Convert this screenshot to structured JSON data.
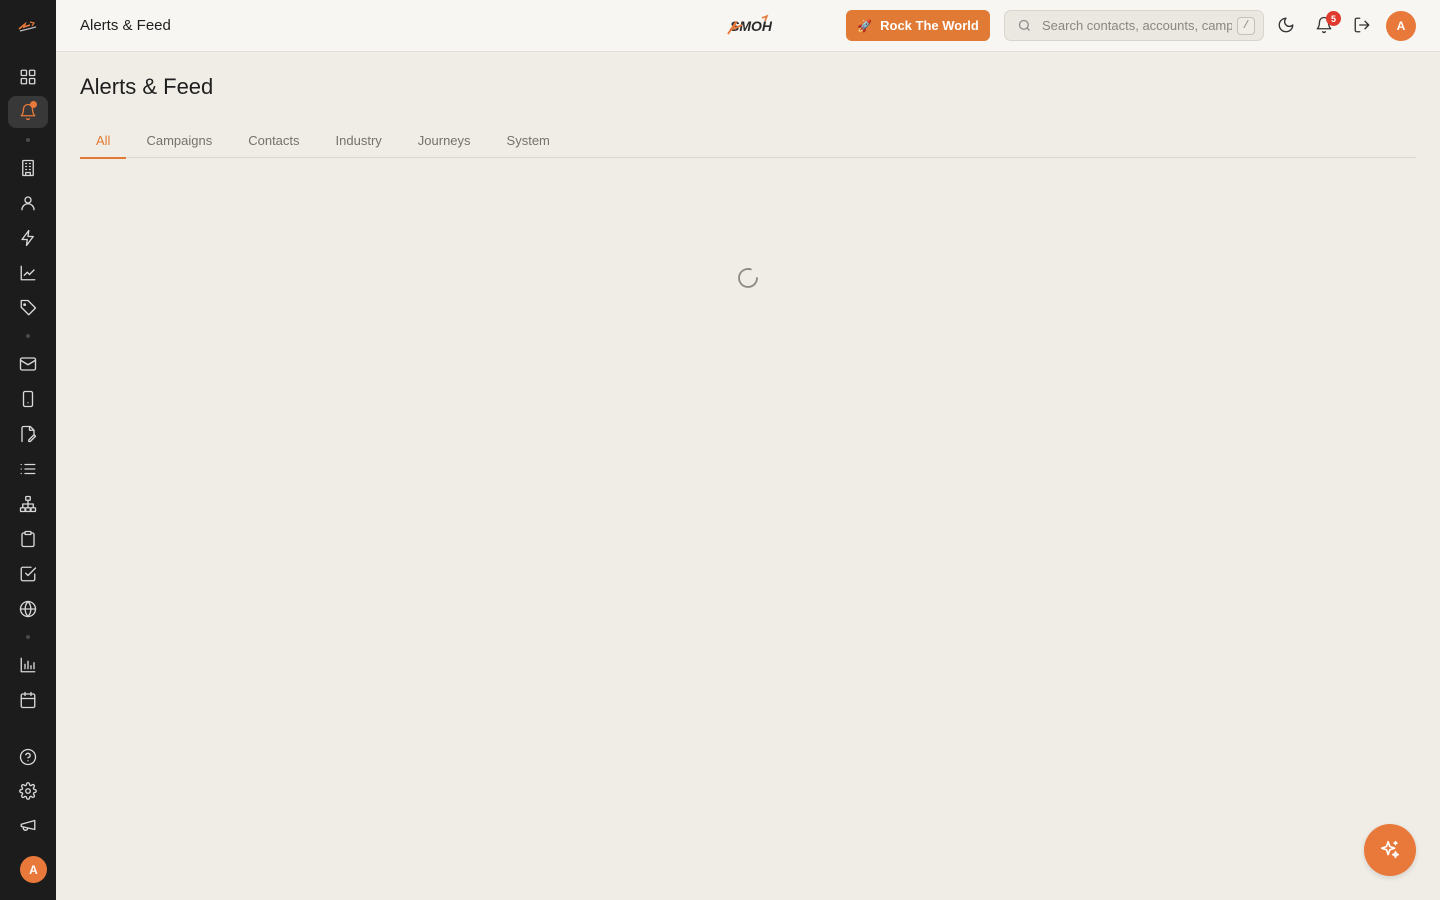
{
  "app": {
    "brand_name": "SMOH",
    "accent_color": "#e07a35"
  },
  "header": {
    "title": "Alerts & Feed",
    "cta_label": "Rock The World",
    "search_placeholder": "Search contacts, accounts, campaigns...",
    "search_shortcut": "/",
    "notification_count": "5",
    "avatar_initial": "A"
  },
  "sidebar": {
    "items": [
      {
        "name": "dashboard",
        "icon": "grid-icon",
        "active": false
      },
      {
        "name": "alerts",
        "icon": "bell-icon",
        "active": true
      },
      {
        "name": "accounts",
        "icon": "building-icon",
        "active": false
      },
      {
        "name": "contacts",
        "icon": "user-icon",
        "active": false
      },
      {
        "name": "automations",
        "icon": "bolt-icon",
        "active": false
      },
      {
        "name": "analytics",
        "icon": "trend-chart-icon",
        "active": false
      },
      {
        "name": "tags",
        "icon": "tag-icon",
        "active": false
      },
      {
        "name": "email",
        "icon": "mail-icon",
        "active": false
      },
      {
        "name": "mobile",
        "icon": "phone-icon",
        "active": false
      },
      {
        "name": "forms",
        "icon": "edit-file-icon",
        "active": false
      },
      {
        "name": "lists",
        "icon": "list-icon",
        "active": false
      },
      {
        "name": "hierarchy",
        "icon": "org-chart-icon",
        "active": false
      },
      {
        "name": "clipboard",
        "icon": "clipboard-icon",
        "active": false
      },
      {
        "name": "tasks",
        "icon": "checkbox-icon",
        "active": false
      },
      {
        "name": "web",
        "icon": "globe-icon",
        "active": false
      },
      {
        "name": "reports",
        "icon": "bar-chart-icon",
        "active": false
      },
      {
        "name": "calendar",
        "icon": "calendar-icon",
        "active": false
      },
      {
        "name": "help",
        "icon": "help-icon",
        "active": false
      },
      {
        "name": "settings",
        "icon": "gear-icon",
        "active": false
      },
      {
        "name": "announcements",
        "icon": "megaphone-icon",
        "active": false
      }
    ],
    "avatar_initial": "A"
  },
  "main": {
    "page_title": "Alerts & Feed",
    "tabs": [
      {
        "label": "All",
        "active": true
      },
      {
        "label": "Campaigns",
        "active": false
      },
      {
        "label": "Contacts",
        "active": false
      },
      {
        "label": "Industry",
        "active": false
      },
      {
        "label": "Journeys",
        "active": false
      },
      {
        "label": "System",
        "active": false
      }
    ],
    "loading": true
  },
  "fab": {
    "icon": "sparkles-icon"
  }
}
